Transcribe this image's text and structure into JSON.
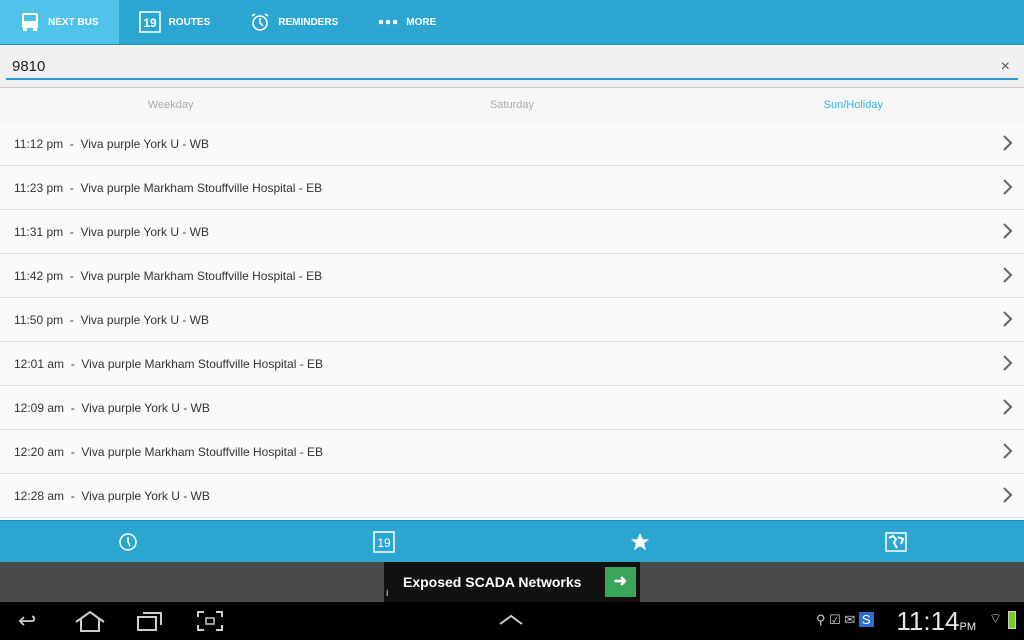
{
  "tabs": [
    {
      "label": "NEXT BUS",
      "icon": "bus-icon"
    },
    {
      "label": "ROUTES",
      "icon": "calendar-icon",
      "badge": "19"
    },
    {
      "label": "REMINDERS",
      "icon": "alarm-clock-icon"
    },
    {
      "label": "MORE",
      "icon": "more-dots-icon"
    }
  ],
  "search": {
    "value": "9810",
    "clear": "×"
  },
  "days": [
    "Weekday",
    "Saturday",
    "Sun/Holiday"
  ],
  "selected_day": "Sun/Holiday",
  "trips": [
    "11:12 pm  -  Viva purple York U - WB",
    "11:23 pm  -  Viva purple Markham Stouffville Hospital - EB",
    "11:31 pm  -  Viva purple York U - WB",
    "11:42 pm  -  Viva purple Markham Stouffville Hospital - EB",
    "11:50 pm  -  Viva purple York U - WB",
    "12:01 am  -  Viva purple Markham Stouffville Hospital - EB",
    "12:09 am  -  Viva purple York U - WB",
    "12:20 am  -  Viva purple Markham Stouffville Hospital - EB",
    "12:28 am  -  Viva purple York U - WB"
  ],
  "bottom": {
    "calendar_badge": "19"
  },
  "ad": {
    "text": "Exposed SCADA Networks",
    "info": "i",
    "arrow": "➜"
  },
  "status": {
    "time": "11:14",
    "ampm": "PM"
  }
}
